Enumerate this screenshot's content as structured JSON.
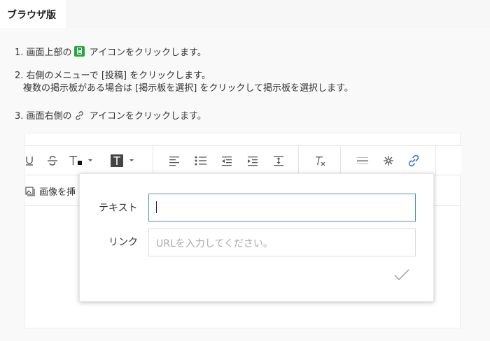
{
  "tab": {
    "label": "ブラウザ版"
  },
  "steps": [
    {
      "prefix": "1. 画面上部の",
      "suffix": " アイコンをクリックします。"
    },
    {
      "line1": "2. 右側のメニューで [投稿] をクリックします。",
      "line2": "複数の掲示板がある場合は [掲示板を選択] をクリックして掲示板を選択します。"
    },
    {
      "prefix": "3. 画面右側の",
      "suffix": " アイコンをクリックします。"
    }
  ],
  "editor": {
    "insert_image_label": "画像を挿"
  },
  "link_popup": {
    "text_label": "テキスト",
    "text_value": "",
    "link_label": "リンク",
    "link_placeholder": "URLを入力してください。"
  },
  "colors": {
    "accent_green": "#22a93c",
    "link_blue": "#3b7bd6",
    "focus_border": "#4a90d9"
  }
}
